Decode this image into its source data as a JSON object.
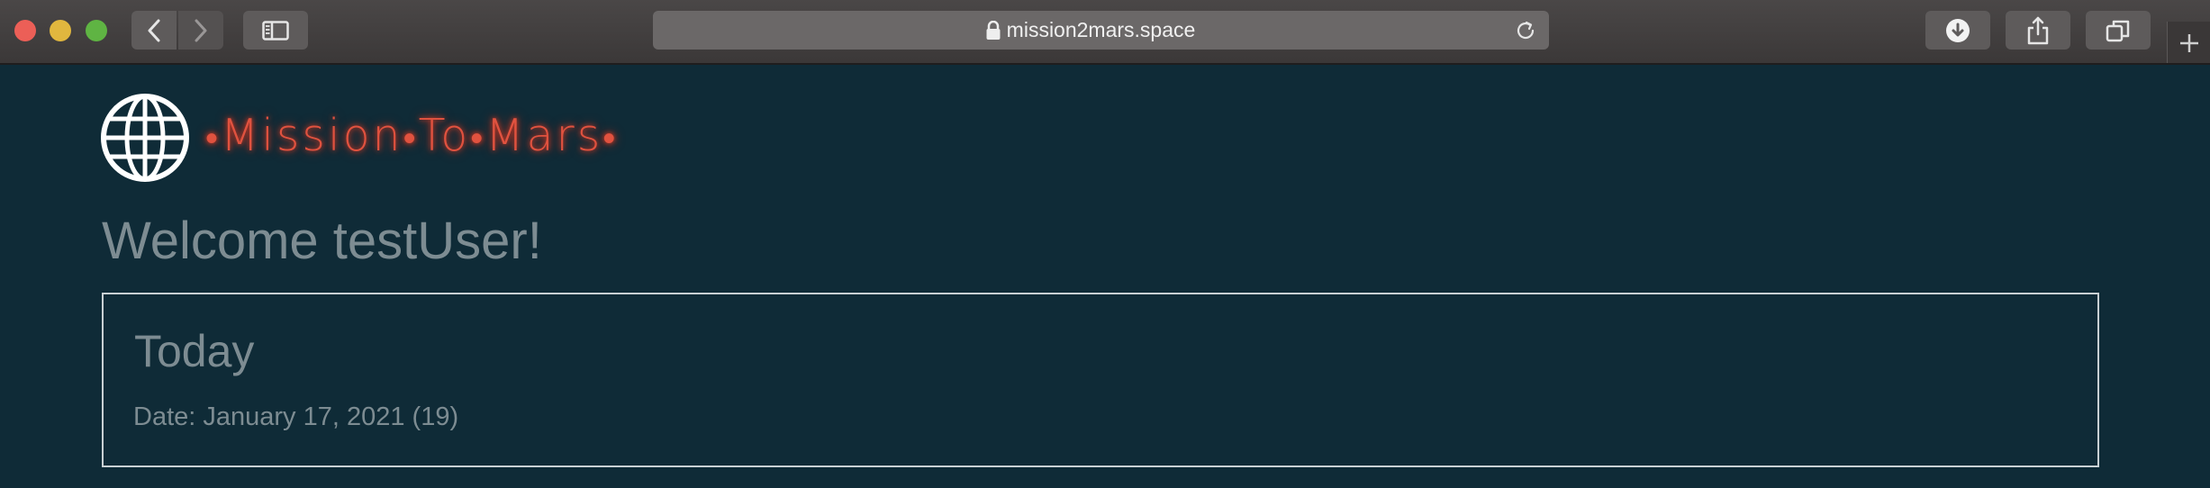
{
  "browser": {
    "url": "mission2mars.space",
    "icons": {
      "back": "chevron-left-icon",
      "forward": "chevron-right-icon",
      "sidebar": "sidebar-icon",
      "lock": "lock-icon",
      "reload": "reload-icon",
      "download": "download-icon",
      "share": "share-icon",
      "tabs": "tabs-overview-icon",
      "new_tab": "plus-icon"
    }
  },
  "site": {
    "brand_dot": "•",
    "brand_words": [
      "Mission",
      "To",
      "Mars"
    ],
    "brand_color": "#e0523f",
    "logo_icon": "globe-icon"
  },
  "page": {
    "welcome": "Welcome testUser!",
    "card": {
      "title": "Today",
      "date_line": "Date: January 17, 2021 (19)"
    }
  },
  "colors": {
    "background": "#0f2b37",
    "text_muted": "#7d8c92"
  }
}
